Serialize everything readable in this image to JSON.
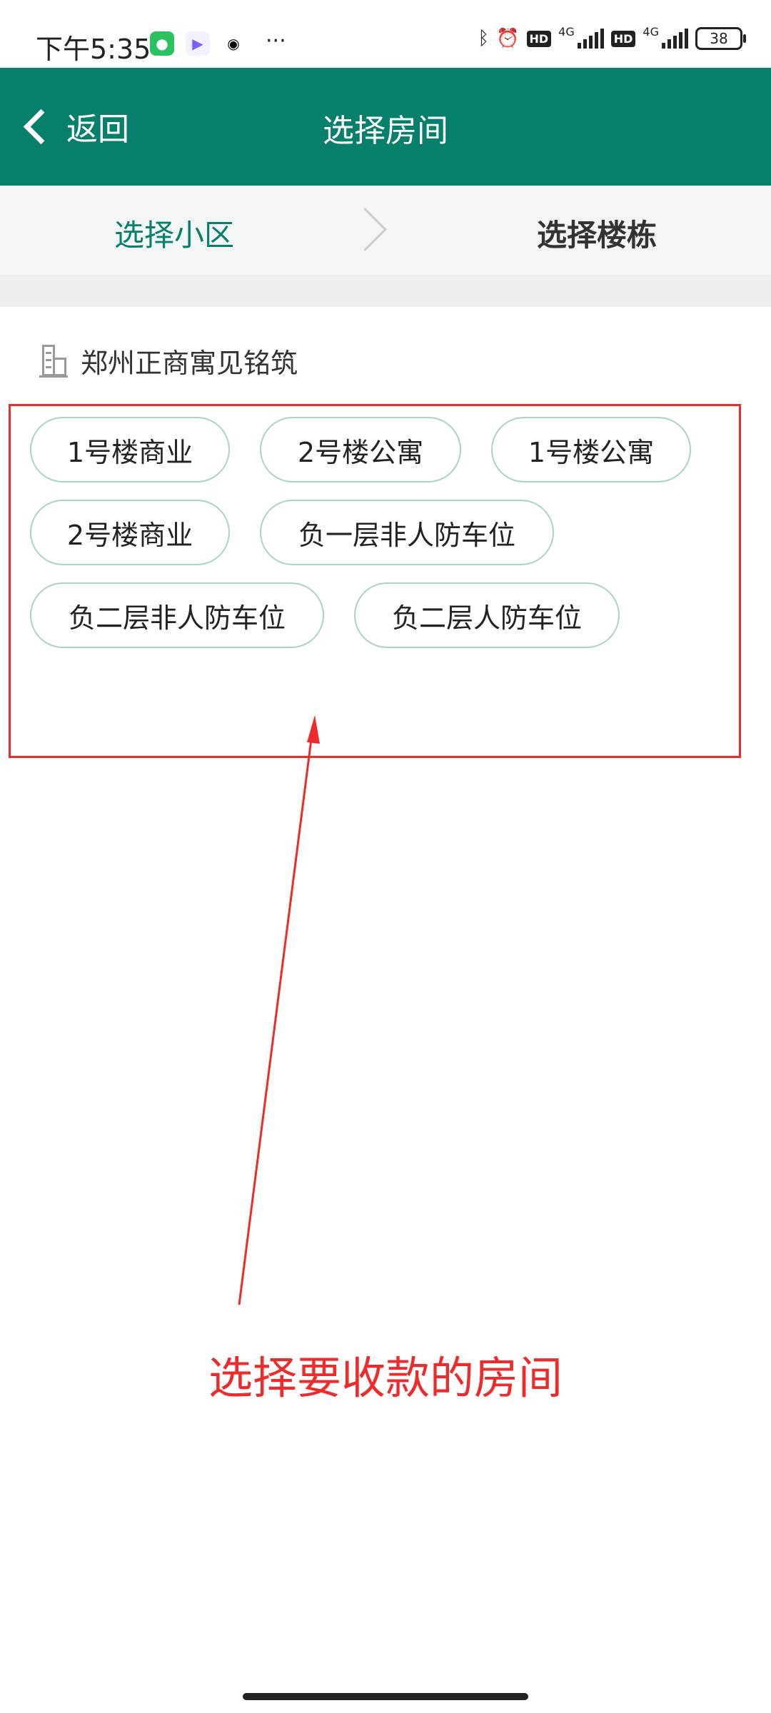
{
  "status_bar": {
    "time": "下午5:35",
    "more": "···",
    "hd1": "HD",
    "net1": "4G",
    "hd2": "HD",
    "net2": "4G",
    "battery": "38"
  },
  "header": {
    "back_label": "返回",
    "title": "选择房间"
  },
  "steps": {
    "step1": "选择小区",
    "step2": "选择楼栋"
  },
  "community": {
    "name": "郑州正商寓见铭筑"
  },
  "buildings": [
    "1号楼商业",
    "2号楼公寓",
    "1号楼公寓",
    "2号楼商业",
    "负一层非人防车位",
    "负二层非人防车位",
    "负二层人防车位"
  ],
  "annotation": {
    "text": "选择要收款的房间",
    "color": "#ee2b2b"
  },
  "colors": {
    "primary": "#06806b",
    "chip_border": "#a8d4c6"
  }
}
